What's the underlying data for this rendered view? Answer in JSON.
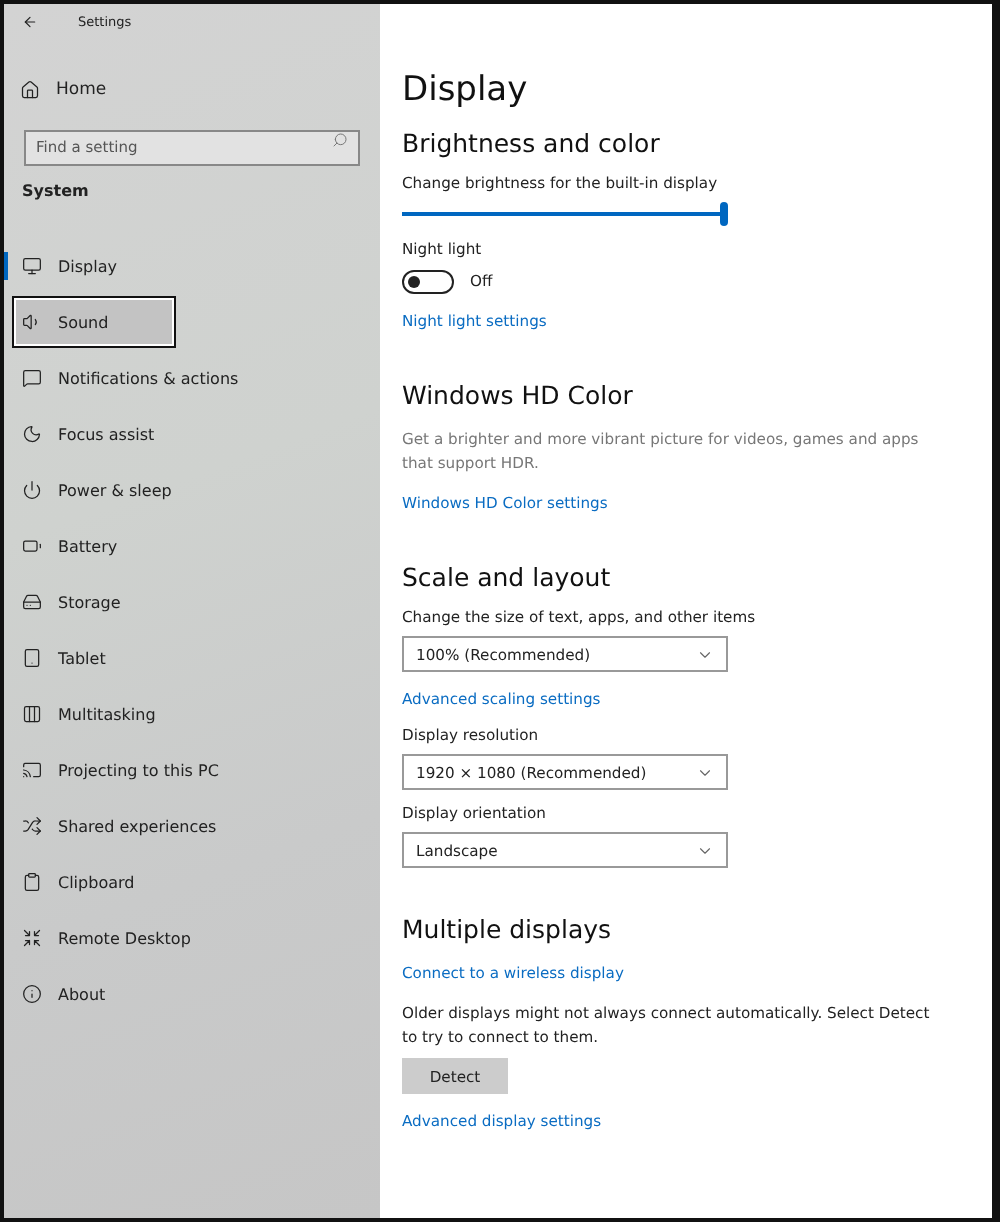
{
  "window": {
    "title": "Settings"
  },
  "sidebar": {
    "home": "Home",
    "search": {
      "placeholder": "Find a setting"
    },
    "section": "System",
    "items": [
      {
        "label": "Display",
        "selected": true,
        "focused": false
      },
      {
        "label": "Sound",
        "selected": false,
        "focused": true
      },
      {
        "label": "Notifications & actions",
        "selected": false,
        "focused": false
      },
      {
        "label": "Focus assist",
        "selected": false,
        "focused": false
      },
      {
        "label": "Power & sleep",
        "selected": false,
        "focused": false
      },
      {
        "label": "Battery",
        "selected": false,
        "focused": false
      },
      {
        "label": "Storage",
        "selected": false,
        "focused": false
      },
      {
        "label": "Tablet",
        "selected": false,
        "focused": false
      },
      {
        "label": "Multitasking",
        "selected": false,
        "focused": false
      },
      {
        "label": "Projecting to this PC",
        "selected": false,
        "focused": false
      },
      {
        "label": "Shared experiences",
        "selected": false,
        "focused": false
      },
      {
        "label": "Clipboard",
        "selected": false,
        "focused": false
      },
      {
        "label": "Remote Desktop",
        "selected": false,
        "focused": false
      },
      {
        "label": "About",
        "selected": false,
        "focused": false
      }
    ]
  },
  "content": {
    "title": "Display",
    "sections": [
      {
        "heading": "Brightness and color",
        "items": [
          {
            "kind": "label",
            "text": "Change brightness for the built-in display"
          },
          {
            "kind": "slider",
            "level": 1
          },
          {
            "kind": "label",
            "text": "Night light"
          },
          {
            "kind": "toggle",
            "on": false,
            "state_text": "Off"
          },
          {
            "kind": "link",
            "text": "Night light settings"
          }
        ]
      },
      {
        "heading": "Windows HD Color",
        "items": [
          {
            "kind": "text",
            "text": "Get a brighter and more vibrant picture for videos, games and apps that support HDR."
          },
          {
            "kind": "link",
            "text": "Windows HD Color settings"
          }
        ]
      },
      {
        "heading": "Scale and layout",
        "items": [
          {
            "kind": "label",
            "text": "Change the size of text, apps, and other items"
          },
          {
            "kind": "dropdown",
            "value": "100% (Recommended)"
          },
          {
            "kind": "link",
            "text": "Advanced scaling settings"
          },
          {
            "kind": "label",
            "text": "Display resolution"
          },
          {
            "kind": "dropdown",
            "value": "1920 × 1080 (Recommended)"
          },
          {
            "kind": "label",
            "text": "Display orientation"
          },
          {
            "kind": "dropdown",
            "value": "Landscape"
          }
        ]
      },
      {
        "heading": "Multiple displays",
        "items": [
          {
            "kind": "link",
            "text": "Connect to a wireless display"
          },
          {
            "kind": "body",
            "text": "Older displays might not always connect automatically. Select Detect to try to connect to them."
          },
          {
            "kind": "button",
            "text": "Detect"
          },
          {
            "kind": "link",
            "text": "Advanced display settings"
          }
        ]
      }
    ]
  }
}
